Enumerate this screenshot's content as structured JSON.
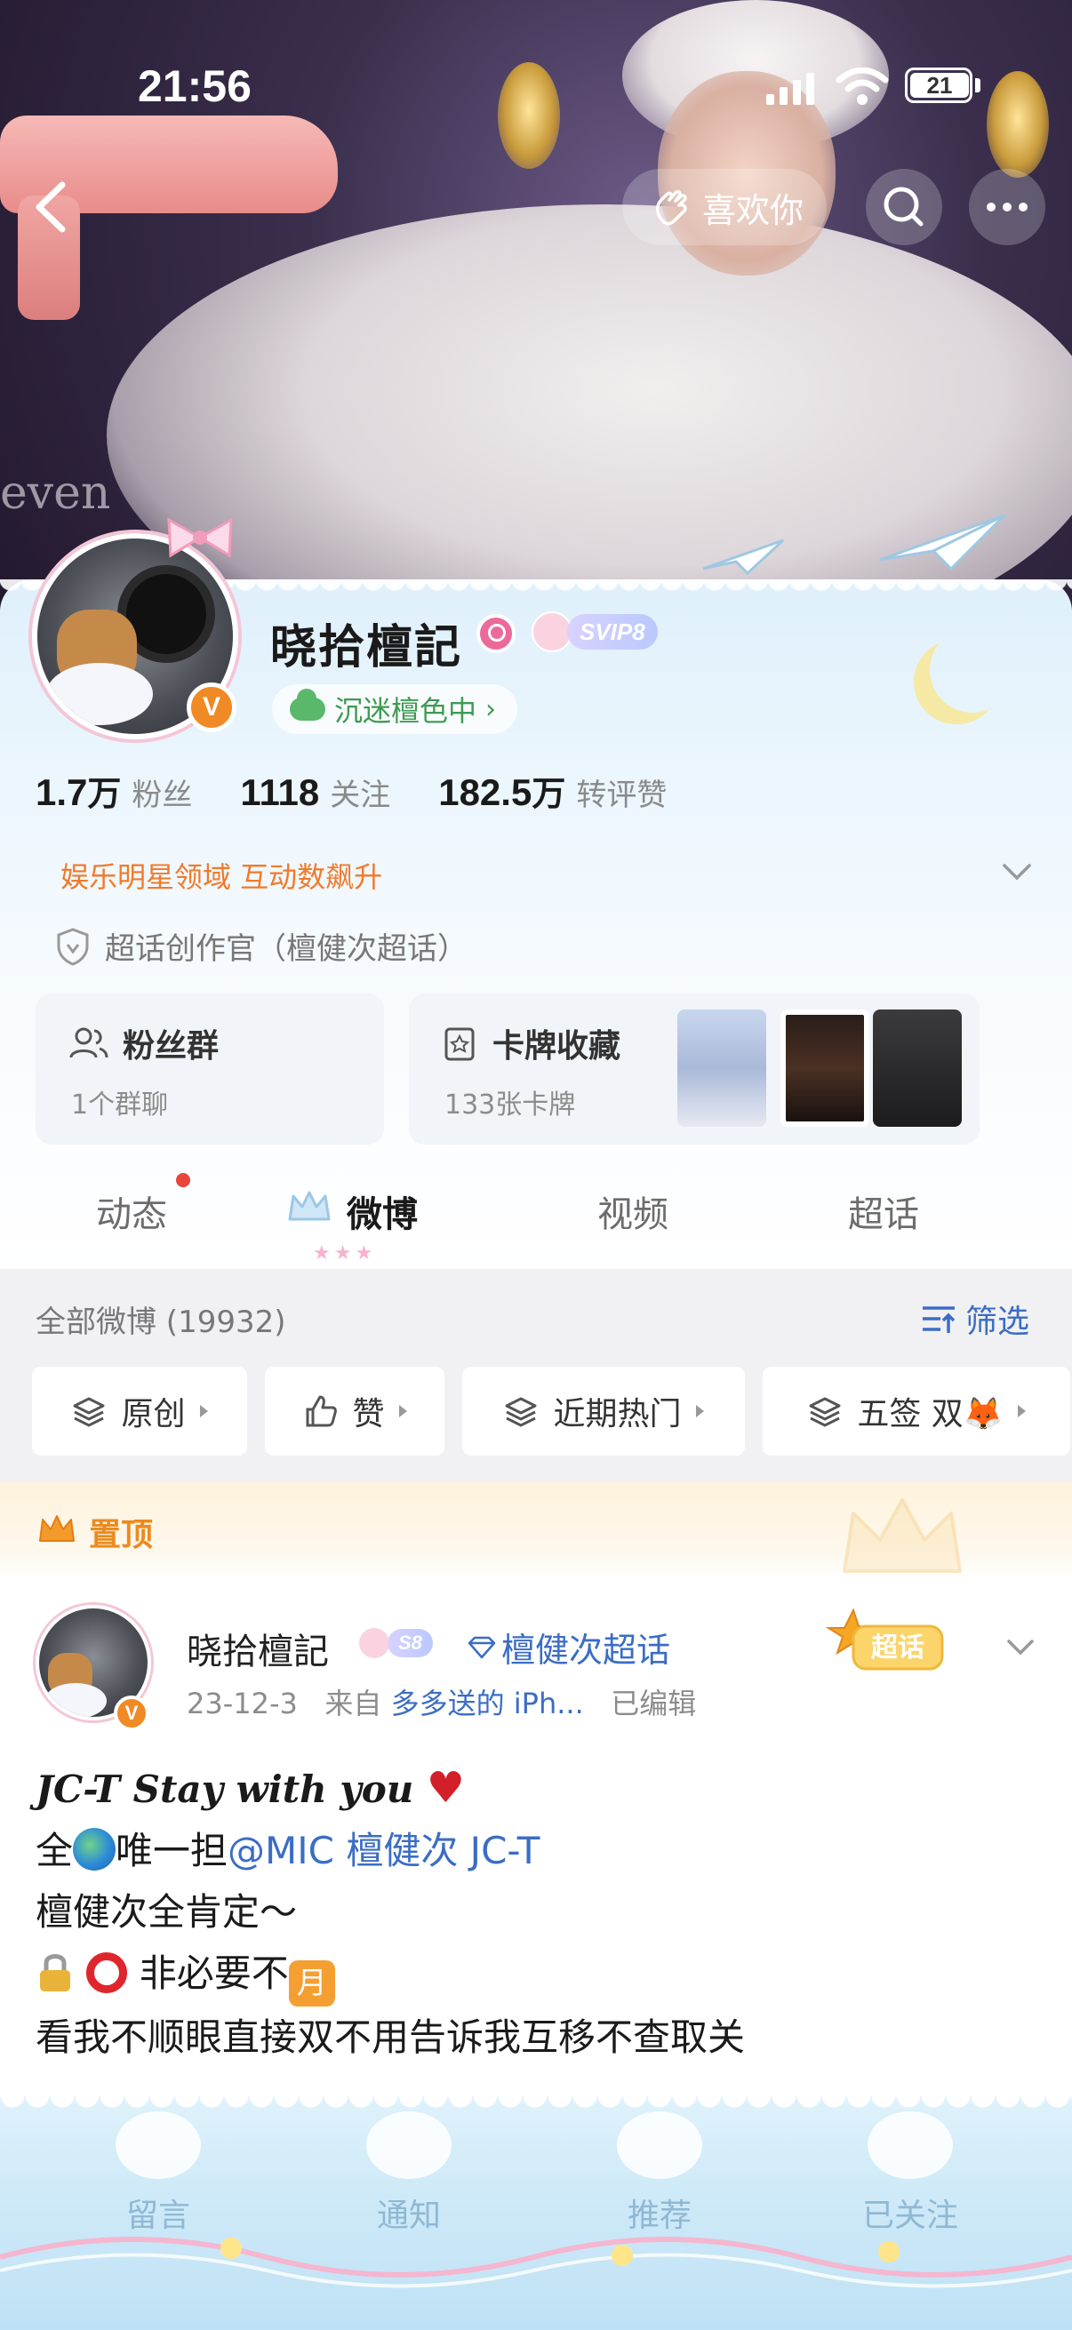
{
  "status_bar": {
    "time": "21:56",
    "battery": "21"
  },
  "nav": {
    "like_label": "喜欢你"
  },
  "hero": {
    "word": "even"
  },
  "profile": {
    "username": "晓拾檀記",
    "vip_badge": "SVIP8",
    "verified_mark": "V",
    "status_text": "沉迷檀色中",
    "status_chevron": "›",
    "stats": [
      {
        "num": "1.7",
        "unit": "万",
        "label": "粉丝"
      },
      {
        "num": "1118",
        "unit": "",
        "label": "关注"
      },
      {
        "num": "182.5",
        "unit": "万",
        "label": "转评赞"
      }
    ],
    "domain_tag": "娱乐明星领域 互动数飙升",
    "super_topic_role": "超话创作官（檀健次超话）",
    "fans_group": {
      "title": "粉丝群",
      "sub": "1个群聊"
    },
    "card_collection": {
      "title": "卡牌收藏",
      "sub": "133张卡牌"
    }
  },
  "tabs": [
    {
      "label": "动态"
    },
    {
      "label": "微博"
    },
    {
      "label": "视频"
    },
    {
      "label": "超话"
    }
  ],
  "filter": {
    "all_count": "全部微博 (19932)",
    "filter_label": "筛选",
    "chips": [
      {
        "label": "原创"
      },
      {
        "label": "赞"
      },
      {
        "label": "近期热门"
      },
      {
        "label": "五签 双🦊"
      }
    ]
  },
  "pinned": {
    "banner_label": "置顶",
    "author": "晓拾檀記",
    "badge": "S8",
    "topic": "檀健次超话",
    "sticker": "超话",
    "date": "23-12-3",
    "from_prefix": "来自",
    "source": "多多送的 iPh...",
    "edited": "已编辑",
    "lines": {
      "l1": "JC-T Stay with you",
      "l2_a": "全",
      "l2_b": "唯一担",
      "l2_mention": "@MIC 檀健次 JC-T",
      "l3": "檀健次全肯定～",
      "l4": "非必要不",
      "l4_sign": "月",
      "l5": "看我不顺眼直接双不用告诉我互移不查取关"
    }
  },
  "bottom_bar": [
    {
      "label": "留言"
    },
    {
      "label": "通知"
    },
    {
      "label": "推荐"
    },
    {
      "label": "已关注"
    }
  ],
  "colors": {
    "accent_blue": "#3b6dc5",
    "orange": "#f07a2a",
    "verified_orange": "#f08a24",
    "status_green": "#3f9a52"
  }
}
